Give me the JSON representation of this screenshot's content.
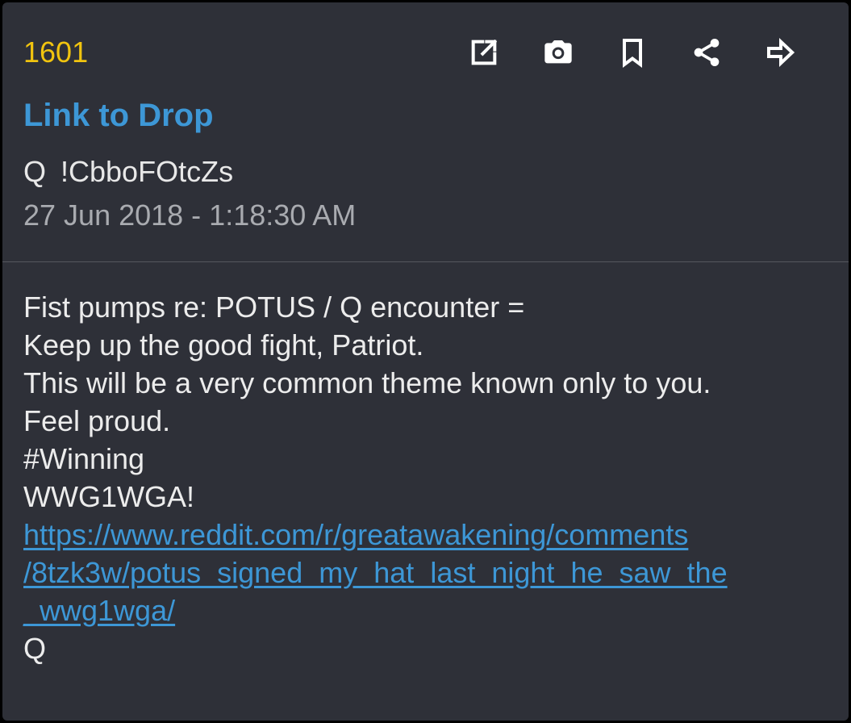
{
  "drop": {
    "number": "1601",
    "link_label": "Link to Drop",
    "author_name": "Q",
    "tripcode": "!CbboFOtcZs",
    "timestamp": "27 Jun 2018 - 1:18:30 AM"
  },
  "toolbar": {
    "icons": [
      "open-external-icon",
      "camera-icon",
      "bookmark-icon",
      "share-icon",
      "forward-icon"
    ]
  },
  "body": {
    "lines": [
      "Fist pumps re: POTUS / Q encounter =",
      "Keep up the good fight, Patriot.",
      "This will be a very common theme known only to you.",
      "Feel proud.",
      "#Winning",
      "WWG1WGA!"
    ],
    "link_lines": [
      "https://www.reddit.com/r/greatawakening/comments",
      "/8tzk3w/potus_signed_my_hat_last_night_he_saw_the",
      "_wwg1wga/"
    ],
    "signature": "Q"
  },
  "colors": {
    "background": "#2e3038",
    "drop_number": "#f1c40f",
    "link": "#3d97d6",
    "text": "#ececec",
    "muted_text": "#a9abb0"
  }
}
